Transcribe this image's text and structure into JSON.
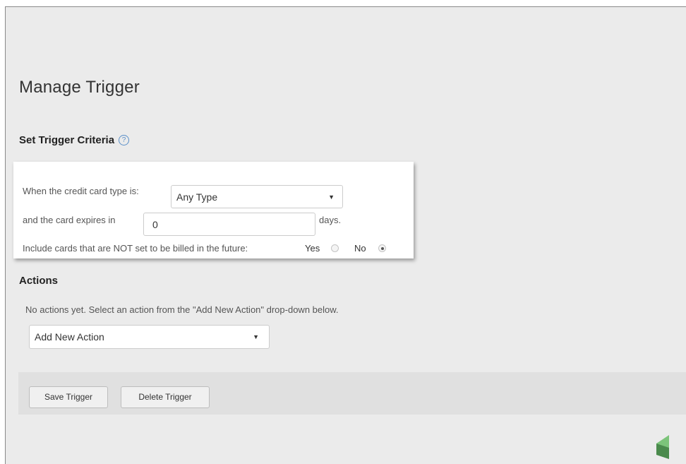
{
  "page": {
    "title": "Manage Trigger"
  },
  "criteria": {
    "heading": "Set Trigger Criteria",
    "help_glyph": "?",
    "card_type_label": "When the credit card type is:",
    "card_type_value": "Any Type",
    "expires_label": "and the card expires in",
    "expires_value": "0",
    "days_label": "days.",
    "include_label": "Include cards that are NOT set to be billed in the future:",
    "yes_label": "Yes",
    "no_label": "No",
    "include_selected": "No"
  },
  "actions": {
    "heading": "Actions",
    "empty_message": "No actions yet. Select an action from the \"Add New Action\" drop-down below.",
    "add_action_value": "Add New Action"
  },
  "footer": {
    "save_label": "Save Trigger",
    "delete_label": "Delete Trigger"
  },
  "icons": {
    "dropdown": "caret-down-icon",
    "help": "help-circle-icon",
    "brand": "logo-icon"
  },
  "colors": {
    "help_icon": "#5a8fc8",
    "logo_light": "#7cc47a",
    "logo_dark": "#4a8a4c"
  }
}
